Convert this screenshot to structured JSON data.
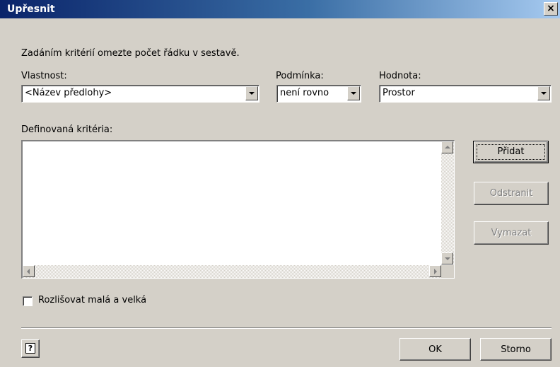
{
  "window": {
    "title": "Upřesnit",
    "close_glyph": "×"
  },
  "intro_text": "Zadáním kritérií omezte počet řádku v sestavě.",
  "property": {
    "label": "Vlastnost:",
    "value": "<Název předlohy>"
  },
  "condition": {
    "label": "Podmínka:",
    "value": "není rovno"
  },
  "value_field": {
    "label": "Hodnota:",
    "value": "Prostor"
  },
  "criteria": {
    "label": "Definovaná kritéria:",
    "items": []
  },
  "buttons": {
    "add": "Přidat",
    "remove": "Odstranit",
    "clear": "Vymazat",
    "ok": "OK",
    "cancel": "Storno",
    "help_glyph": "?"
  },
  "match_case": {
    "label": "Rozlišovat malá a velká",
    "checked": false
  },
  "icons": [
    "close-icon",
    "dropdown-arrow-icon",
    "scroll-up-icon",
    "scroll-down-icon",
    "scroll-left-icon",
    "scroll-right-icon",
    "help-icon"
  ],
  "colors": {
    "titlebar_start": "#0a246a",
    "titlebar_end": "#a6caf0",
    "dialog_bg": "#d4d0c8",
    "disabled_text": "#808080"
  }
}
